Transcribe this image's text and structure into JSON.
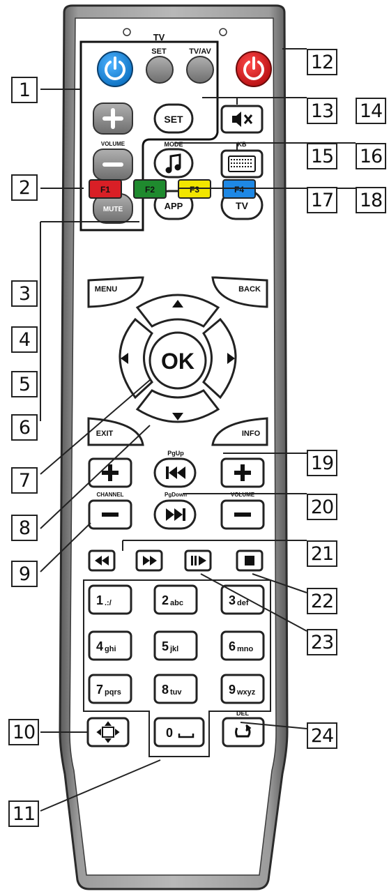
{
  "remote": {
    "top_labels": {
      "tv": "TV",
      "set": "SET",
      "tv_av": "TV/AV"
    },
    "volume_label": "VOLUME",
    "mute_label": "MUTE",
    "set_label": "SET",
    "mode_label": "MODE",
    "kb_label": "KB",
    "app_label": "APP",
    "tv_label": "TV",
    "f_keys": [
      {
        "label": "F1",
        "color": "#d81f26"
      },
      {
        "label": "F2",
        "color": "#1f8a2e"
      },
      {
        "label": "F3",
        "color": "#f2e600"
      },
      {
        "label": "F4",
        "color": "#1e88e5"
      }
    ],
    "menu_label": "MENU",
    "back_label": "BACK",
    "ok_label": "OK",
    "exit_label": "EXIT",
    "info_label": "INFO",
    "pgup_label": "PgUp",
    "pgdown_label": "PgDown",
    "channel_label": "CHANNEL",
    "volume2_label": "VOLUME",
    "digits": [
      {
        "num": "1",
        "sub": ".:/"
      },
      {
        "num": "2",
        "sub": "abc"
      },
      {
        "num": "3",
        "sub": "def"
      },
      {
        "num": "4",
        "sub": "ghi"
      },
      {
        "num": "5",
        "sub": "jkl"
      },
      {
        "num": "6",
        "sub": "mno"
      },
      {
        "num": "7",
        "sub": "pqrs"
      },
      {
        "num": "8",
        "sub": "tuv"
      },
      {
        "num": "9",
        "sub": "wxyz"
      }
    ],
    "zero_label": "0",
    "del_label": "DEL",
    "colors": {
      "power_blue": "#1e90e0",
      "power_red": "#e3191b",
      "body": "#9a9a9a",
      "edge": "#2a2a2a"
    }
  },
  "callouts": [
    "1",
    "2",
    "3",
    "4",
    "5",
    "6",
    "7",
    "8",
    "9",
    "10",
    "11",
    "12",
    "13",
    "14",
    "15",
    "16",
    "17",
    "18",
    "19",
    "20",
    "21",
    "22",
    "23",
    "24"
  ]
}
